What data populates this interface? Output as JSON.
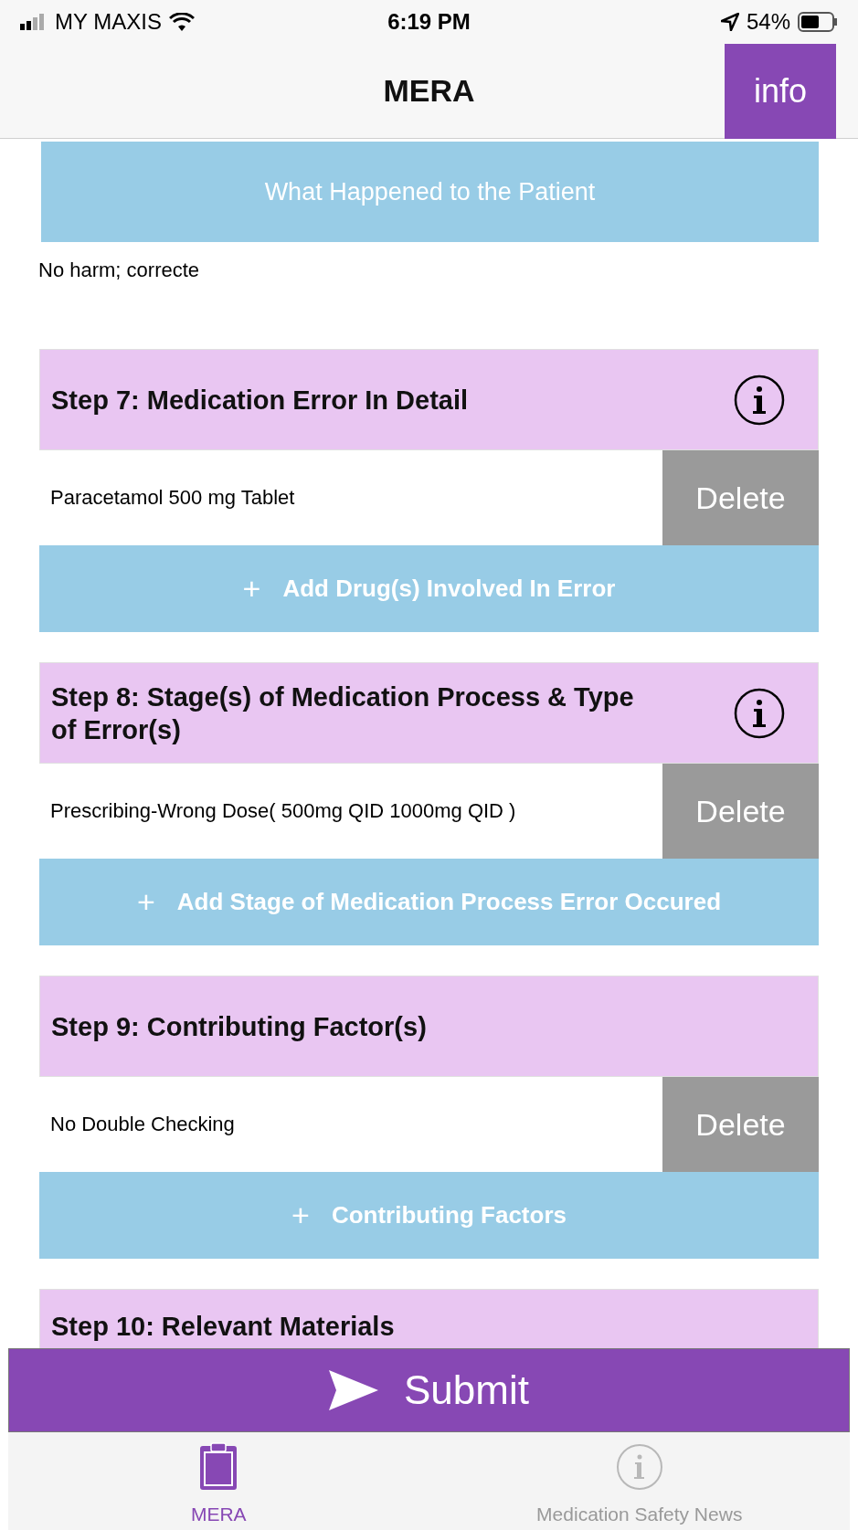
{
  "status_bar": {
    "carrier": "MY MAXIS",
    "time": "6:19 PM",
    "battery": "54%"
  },
  "nav": {
    "title": "MERA",
    "info_button": "info"
  },
  "sections": [
    {
      "kind": "banner",
      "title": "What Happened to the Patient",
      "value": "No harm; correcte"
    },
    {
      "kind": "step",
      "title": "Step 7: Medication Error In Detail",
      "info": true,
      "items": [
        {
          "text": "Paracetamol 500 mg Tablet",
          "action": "Delete"
        }
      ],
      "add_button": {
        "icon": "+",
        "label": "Add Drug(s) Involved In Error"
      }
    },
    {
      "kind": "step",
      "title": "Step 8: Stage(s) of Medication Process & Type of Error(s)",
      "info": true,
      "items": [
        {
          "text": "Prescribing-Wrong Dose( 500mg QID 1000mg QID )",
          "action": "Delete"
        }
      ],
      "add_button": {
        "icon": "+",
        "label": "Add Stage of Medication Process Error Occured"
      }
    },
    {
      "kind": "step",
      "title": "Step 9: Contributing Factor(s)",
      "info": false,
      "items": [
        {
          "text": "No Double Checking",
          "action": "Delete"
        }
      ],
      "add_button": {
        "icon": "+",
        "label": "Contributing Factors"
      }
    },
    {
      "kind": "step",
      "title": "Step 10: Relevant Materials",
      "info": false
    }
  ],
  "submit": "Submit",
  "tabs": [
    {
      "label": "MERA",
      "selected": true
    },
    {
      "label": "Medication Safety News",
      "selected": false
    }
  ]
}
